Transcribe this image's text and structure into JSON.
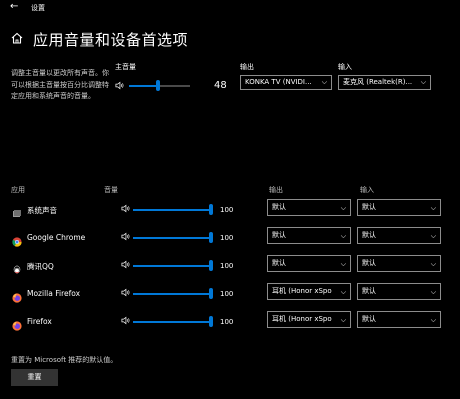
{
  "window": {
    "back_glyph": "←",
    "app_title": "设置"
  },
  "page": {
    "title": "应用音量和设备首选项"
  },
  "master": {
    "description": "调整主音量以更改所有声音。你可以根据主音量按百分比调整特定应用和系统声音的音量。",
    "label": "主音量",
    "value": "48",
    "level": 0.48
  },
  "output": {
    "label": "输出",
    "selected": "KONKA TV (NVIDI..."
  },
  "input": {
    "label": "输入",
    "selected": "麦克风 (Realtek(R)..."
  },
  "table": {
    "col_app": "应用",
    "col_volume": "音量",
    "col_output": "输出",
    "col_input": "输入",
    "rows": [
      {
        "name": "系统声音",
        "icon": "system-sounds-icon",
        "value": "100",
        "level": 1.0,
        "output": "默认",
        "input": "默认"
      },
      {
        "name": "Google Chrome",
        "icon": "chrome-icon",
        "value": "100",
        "level": 1.0,
        "output": "默认",
        "input": "默认"
      },
      {
        "name": "腾讯QQ",
        "icon": "qq-icon",
        "value": "100",
        "level": 1.0,
        "output": "默认",
        "input": "默认"
      },
      {
        "name": "Mozilla Firefox",
        "icon": "firefox-icon",
        "value": "100",
        "level": 1.0,
        "output": "耳机 (Honor xSpo",
        "input": "默认"
      },
      {
        "name": "Firefox",
        "icon": "firefox-icon",
        "value": "100",
        "level": 1.0,
        "output": "耳机 (Honor xSpo",
        "input": "默认"
      }
    ]
  },
  "reset": {
    "note": "重置为 Microsoft 推荐的默认值。",
    "button": "重置"
  },
  "colors": {
    "accent": "#0078d7",
    "background": "#000000"
  }
}
